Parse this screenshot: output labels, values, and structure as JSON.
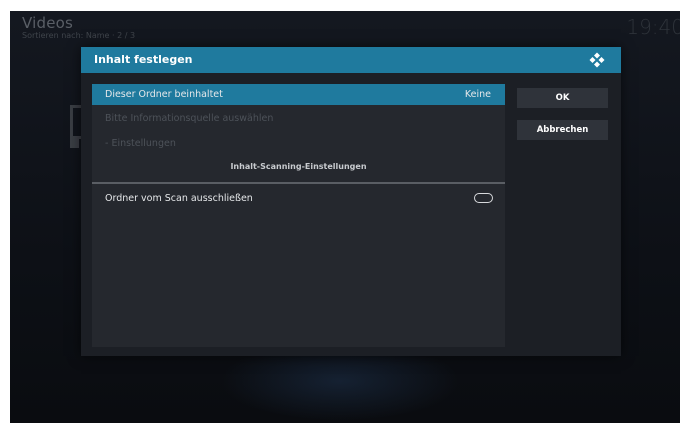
{
  "background": {
    "title": "Videos",
    "subtitle": "Sortieren nach: Name  ·  2 / 3",
    "clock": "19:40"
  },
  "dialog": {
    "title": "Inhalt festlegen",
    "logo_icon": "kodi-logo-icon",
    "accent_color": "#1f7a9e",
    "rows": [
      {
        "label": "Dieser Ordner beinhaltet",
        "value": "Keine"
      },
      {
        "label": "Bitte Informationsquelle auswählen"
      },
      {
        "label": "- Einstellungen"
      }
    ],
    "section_header": "Inhalt-Scanning-Einstellungen",
    "toggle_row": {
      "label": "Ordner vom Scan ausschließen",
      "state": "off"
    },
    "buttons": {
      "ok": "OK",
      "cancel": "Abbrechen"
    }
  }
}
